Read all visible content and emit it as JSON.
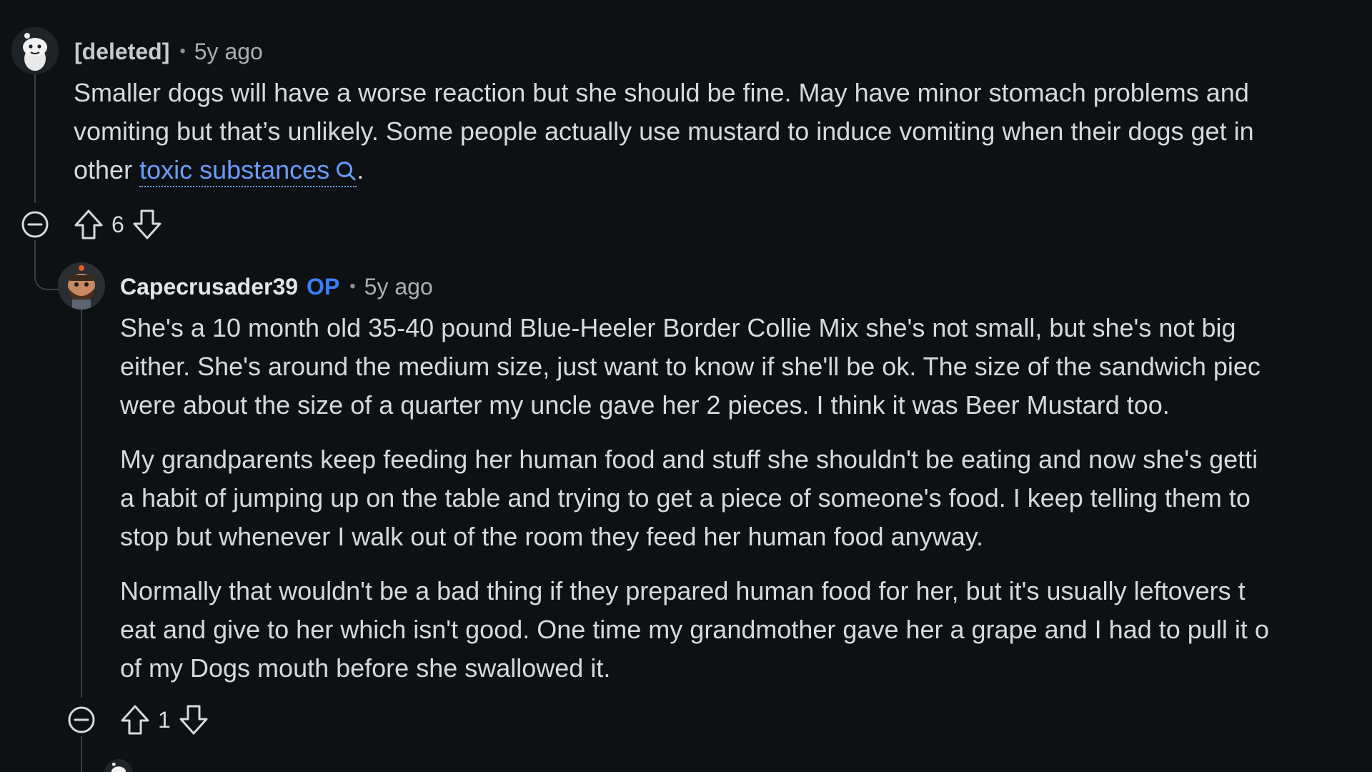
{
  "comments": [
    {
      "author": "[deleted]",
      "time": "5y ago",
      "body_lines": [
        "Smaller dogs will have a worse reaction but she should be fine. May have minor stomach problems and",
        "vomiting but that’s unlikely. Some people actually use mustard to induce vomiting when their dogs get in"
      ],
      "body_last_prefix": "other ",
      "link_text": "toxic substances",
      "body_last_suffix": ".",
      "score": "6",
      "icons": {
        "collapse": "collapse-minus-icon",
        "upvote": "upvote-arrow-icon",
        "downvote": "downvote-arrow-icon",
        "search": "search-icon"
      }
    },
    {
      "author": "Capecrusader39",
      "op_badge": "OP",
      "time": "5y ago",
      "paragraphs": [
        [
          "She's a 10 month old 35-40 pound Blue-Heeler Border Collie Mix she's not small, but she's not big",
          "either. She's around the medium size, just want to know if she'll be ok. The size of the sandwich piec",
          "were about the size of a quarter my uncle gave her 2 pieces. I think it was Beer Mustard too."
        ],
        [
          "My grandparents keep feeding her human food and stuff she shouldn't be eating and now she's getti",
          "a habit of jumping up on the table and trying to get a piece of someone's food. I keep telling them to",
          "stop but whenever I walk out of the room they feed her human food anyway."
        ],
        [
          "Normally that wouldn't be a bad thing if they prepared human food for her, but it's usually leftovers t",
          "eat and give to her which isn't good. One time my grandmother gave her a grape and I had to pull it o",
          "of my Dogs mouth before she swallowed it."
        ]
      ],
      "score": "1"
    }
  ],
  "colors": {
    "background": "#0e1113",
    "text": "#d7dadc",
    "link": "#6c9cff",
    "op_badge": "#3b7eff",
    "thread_line": "#3a3e41"
  }
}
